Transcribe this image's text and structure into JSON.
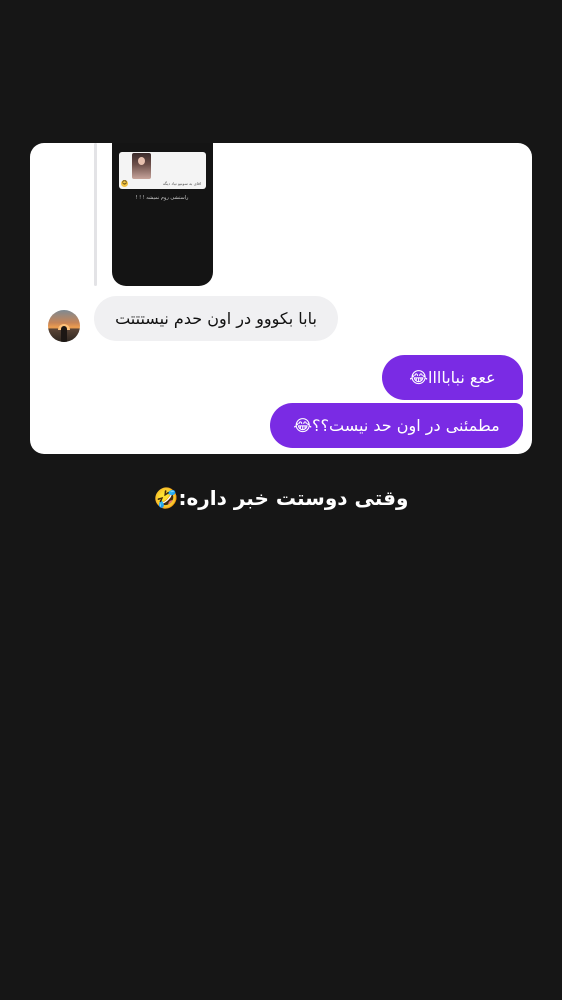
{
  "chat": {
    "shared_story": {
      "card_text": "اقای به سونیو تیاد دیگه",
      "caption": "راستشی روم نمیشه ! ! !"
    },
    "messages": [
      {
        "sender": "other",
        "text": "بابا بکووو در اون حدم نیستتتت"
      },
      {
        "sender": "me",
        "text": "ععع نباباااا😂"
      },
      {
        "sender": "me",
        "text": "مطمئنی در اون حد نیست؟؟😂"
      }
    ]
  },
  "caption": "وقتی دوستت خبر داره:🤣",
  "colors": {
    "background": "#161616",
    "card": "#ffffff",
    "outgoing_bubble": "#7a2be4",
    "incoming_bubble": "#f0f0f2"
  }
}
